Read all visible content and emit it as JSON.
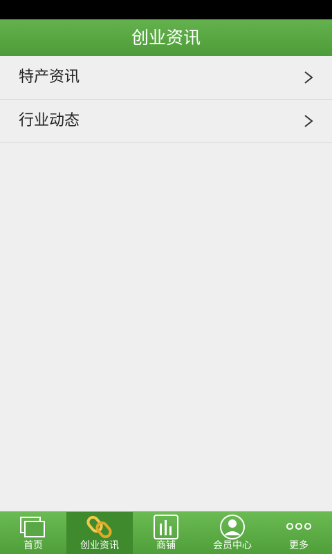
{
  "header": {
    "title": "创业资讯"
  },
  "list": {
    "items": [
      {
        "label": "特产资讯"
      },
      {
        "label": "行业动态"
      }
    ]
  },
  "tabbar": {
    "tabs": [
      {
        "label": "首页",
        "icon": "home-windows-icon"
      },
      {
        "label": "创业资讯",
        "icon": "link-chain-icon",
        "active": true
      },
      {
        "label": "商铺",
        "icon": "bar-chart-icon"
      },
      {
        "label": "会员中心",
        "icon": "user-avatar-icon"
      },
      {
        "label": "更多",
        "icon": "more-dots-icon"
      }
    ]
  },
  "colors": {
    "header_green": "#58a843",
    "active_tab": "#3f8a2d",
    "background": "#efefef"
  }
}
